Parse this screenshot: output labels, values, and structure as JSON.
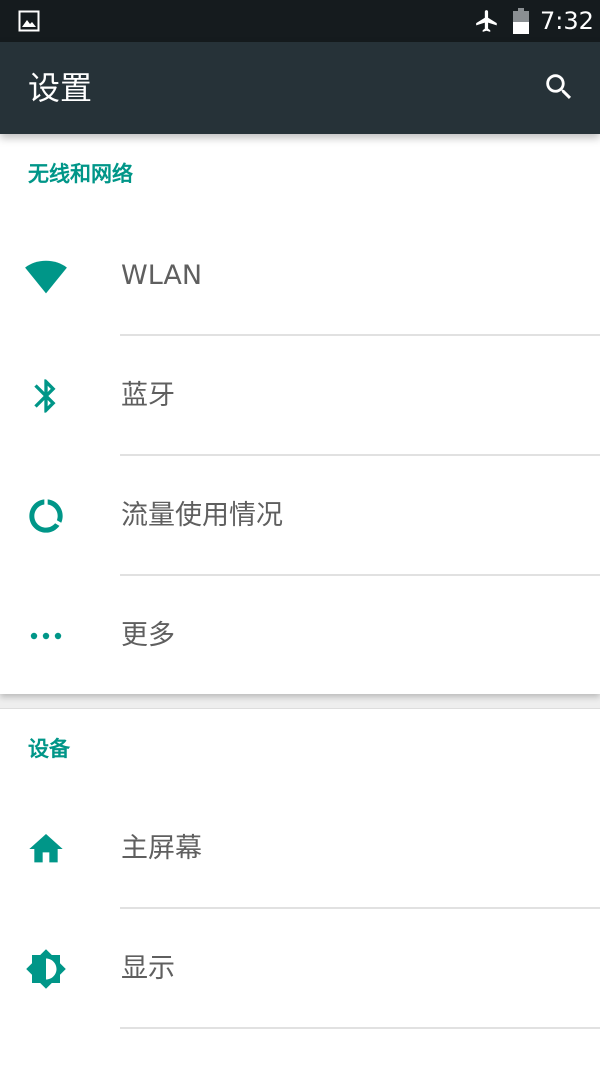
{
  "status_bar": {
    "time": "7:32",
    "icons": [
      "image-notification-icon",
      "airplane-mode-icon",
      "battery-icon"
    ]
  },
  "app_bar": {
    "title": "设置",
    "search_icon": "search-icon"
  },
  "sections": [
    {
      "header": "无线和网络",
      "items": [
        {
          "label": "WLAN",
          "icon": "wifi-icon"
        },
        {
          "label": "蓝牙",
          "icon": "bluetooth-icon"
        },
        {
          "label": "流量使用情况",
          "icon": "data-usage-icon"
        },
        {
          "label": "更多",
          "icon": "more-dots-icon"
        }
      ]
    },
    {
      "header": "设备",
      "items": [
        {
          "label": "主屏幕",
          "icon": "home-icon"
        },
        {
          "label": "显示",
          "icon": "brightness-icon"
        }
      ]
    }
  ],
  "colors": {
    "accent": "#009688",
    "app_bar": "#263238",
    "status_bar": "#151b1e",
    "label_text": "#5f5f5f"
  }
}
